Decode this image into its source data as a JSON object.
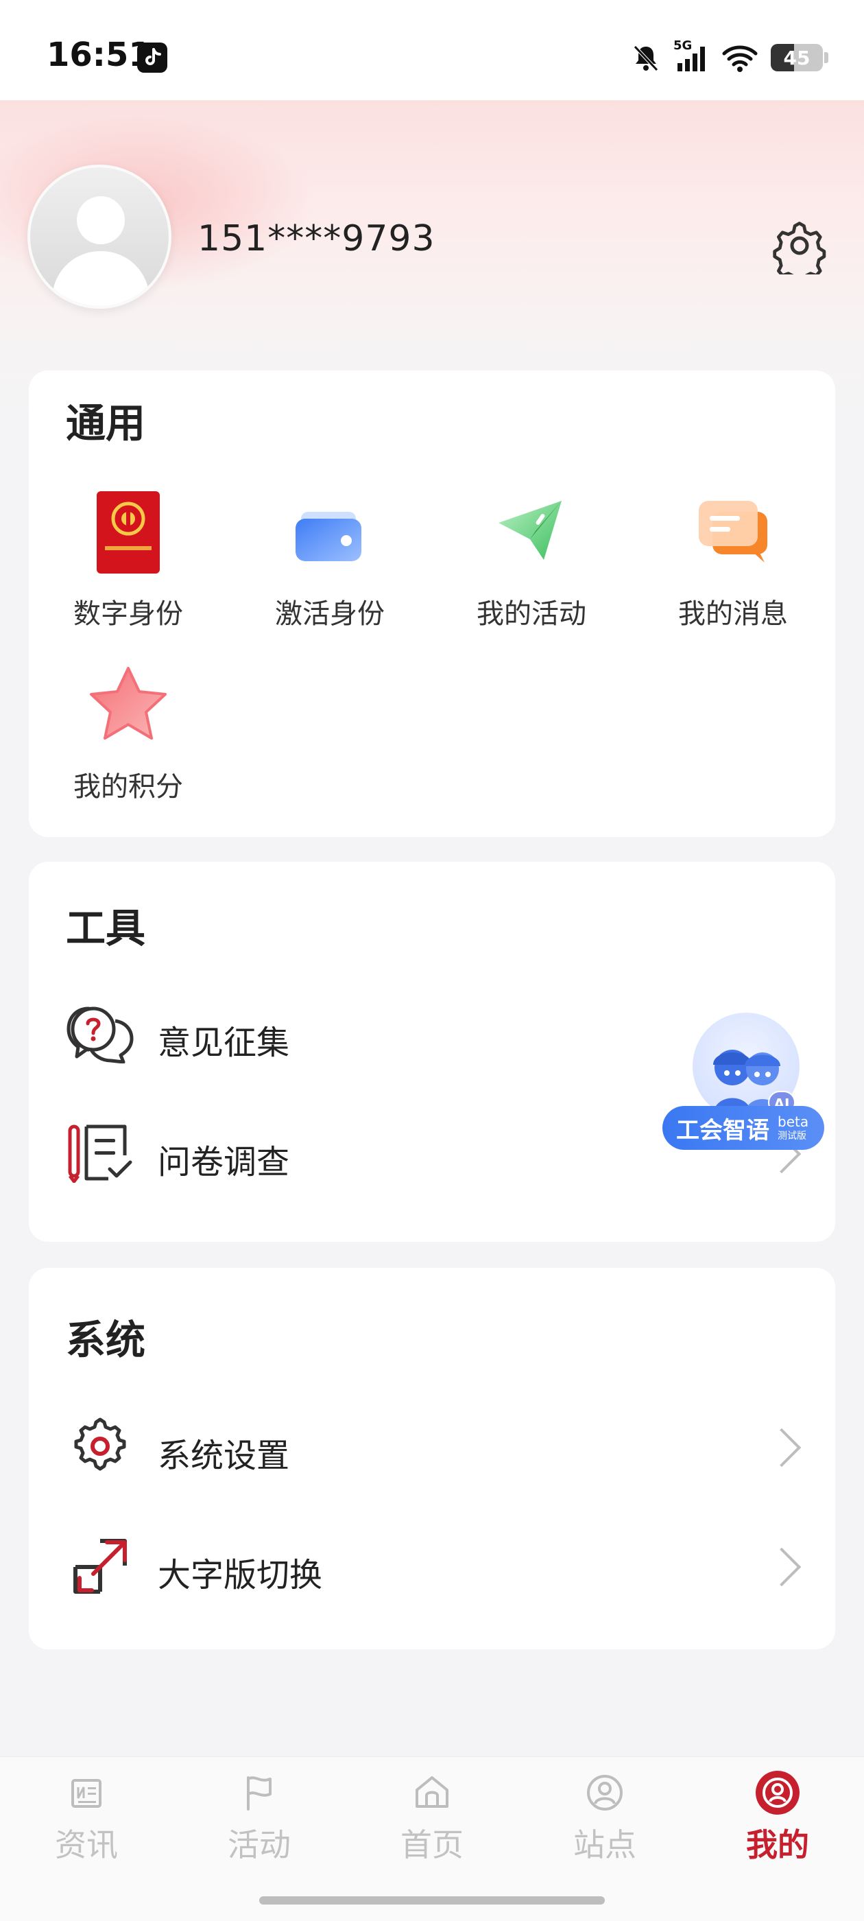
{
  "status_bar": {
    "time": "16:51",
    "network": "5G",
    "battery": "45",
    "icons": [
      "tiktok-icon",
      "bell-off-icon",
      "signal-icon",
      "wifi-icon",
      "battery-icon"
    ]
  },
  "profile": {
    "phone": "151****9793",
    "avatar_icon": "avatar-placeholder-icon",
    "settings_icon": "gear-icon"
  },
  "general": {
    "title": "通用",
    "items": [
      {
        "label": "数字身份",
        "icon": "digital-id-icon"
      },
      {
        "label": "激活身份",
        "icon": "wallet-icon"
      },
      {
        "label": "我的活动",
        "icon": "paper-plane-icon"
      },
      {
        "label": "我的消息",
        "icon": "message-icon"
      },
      {
        "label": "我的积分",
        "icon": "star-icon"
      }
    ]
  },
  "tools": {
    "title": "工具",
    "items": [
      {
        "label": "意见征集",
        "icon": "question-bubble-icon"
      },
      {
        "label": "问卷调查",
        "icon": "survey-icon"
      }
    ]
  },
  "system": {
    "title": "系统",
    "items": [
      {
        "label": "系统设置",
        "icon": "gear-icon"
      },
      {
        "label": "大字版切换",
        "icon": "expand-icon"
      }
    ]
  },
  "ai_assistant": {
    "label": "工会智语",
    "beta": "beta",
    "beta_sub": "测试版",
    "badge": "AI"
  },
  "tabbar": {
    "tabs": [
      {
        "label": "资讯",
        "icon": "news-icon",
        "active": false
      },
      {
        "label": "活动",
        "icon": "flag-icon",
        "active": false
      },
      {
        "label": "首页",
        "icon": "home-icon",
        "active": false
      },
      {
        "label": "站点",
        "icon": "person-circle-icon",
        "active": false
      },
      {
        "label": "我的",
        "icon": "profile-icon",
        "active": true
      }
    ]
  },
  "colors": {
    "accent": "#c6202e",
    "inactive": "#c2c2c2",
    "ai_blue": "#3a78f2"
  }
}
